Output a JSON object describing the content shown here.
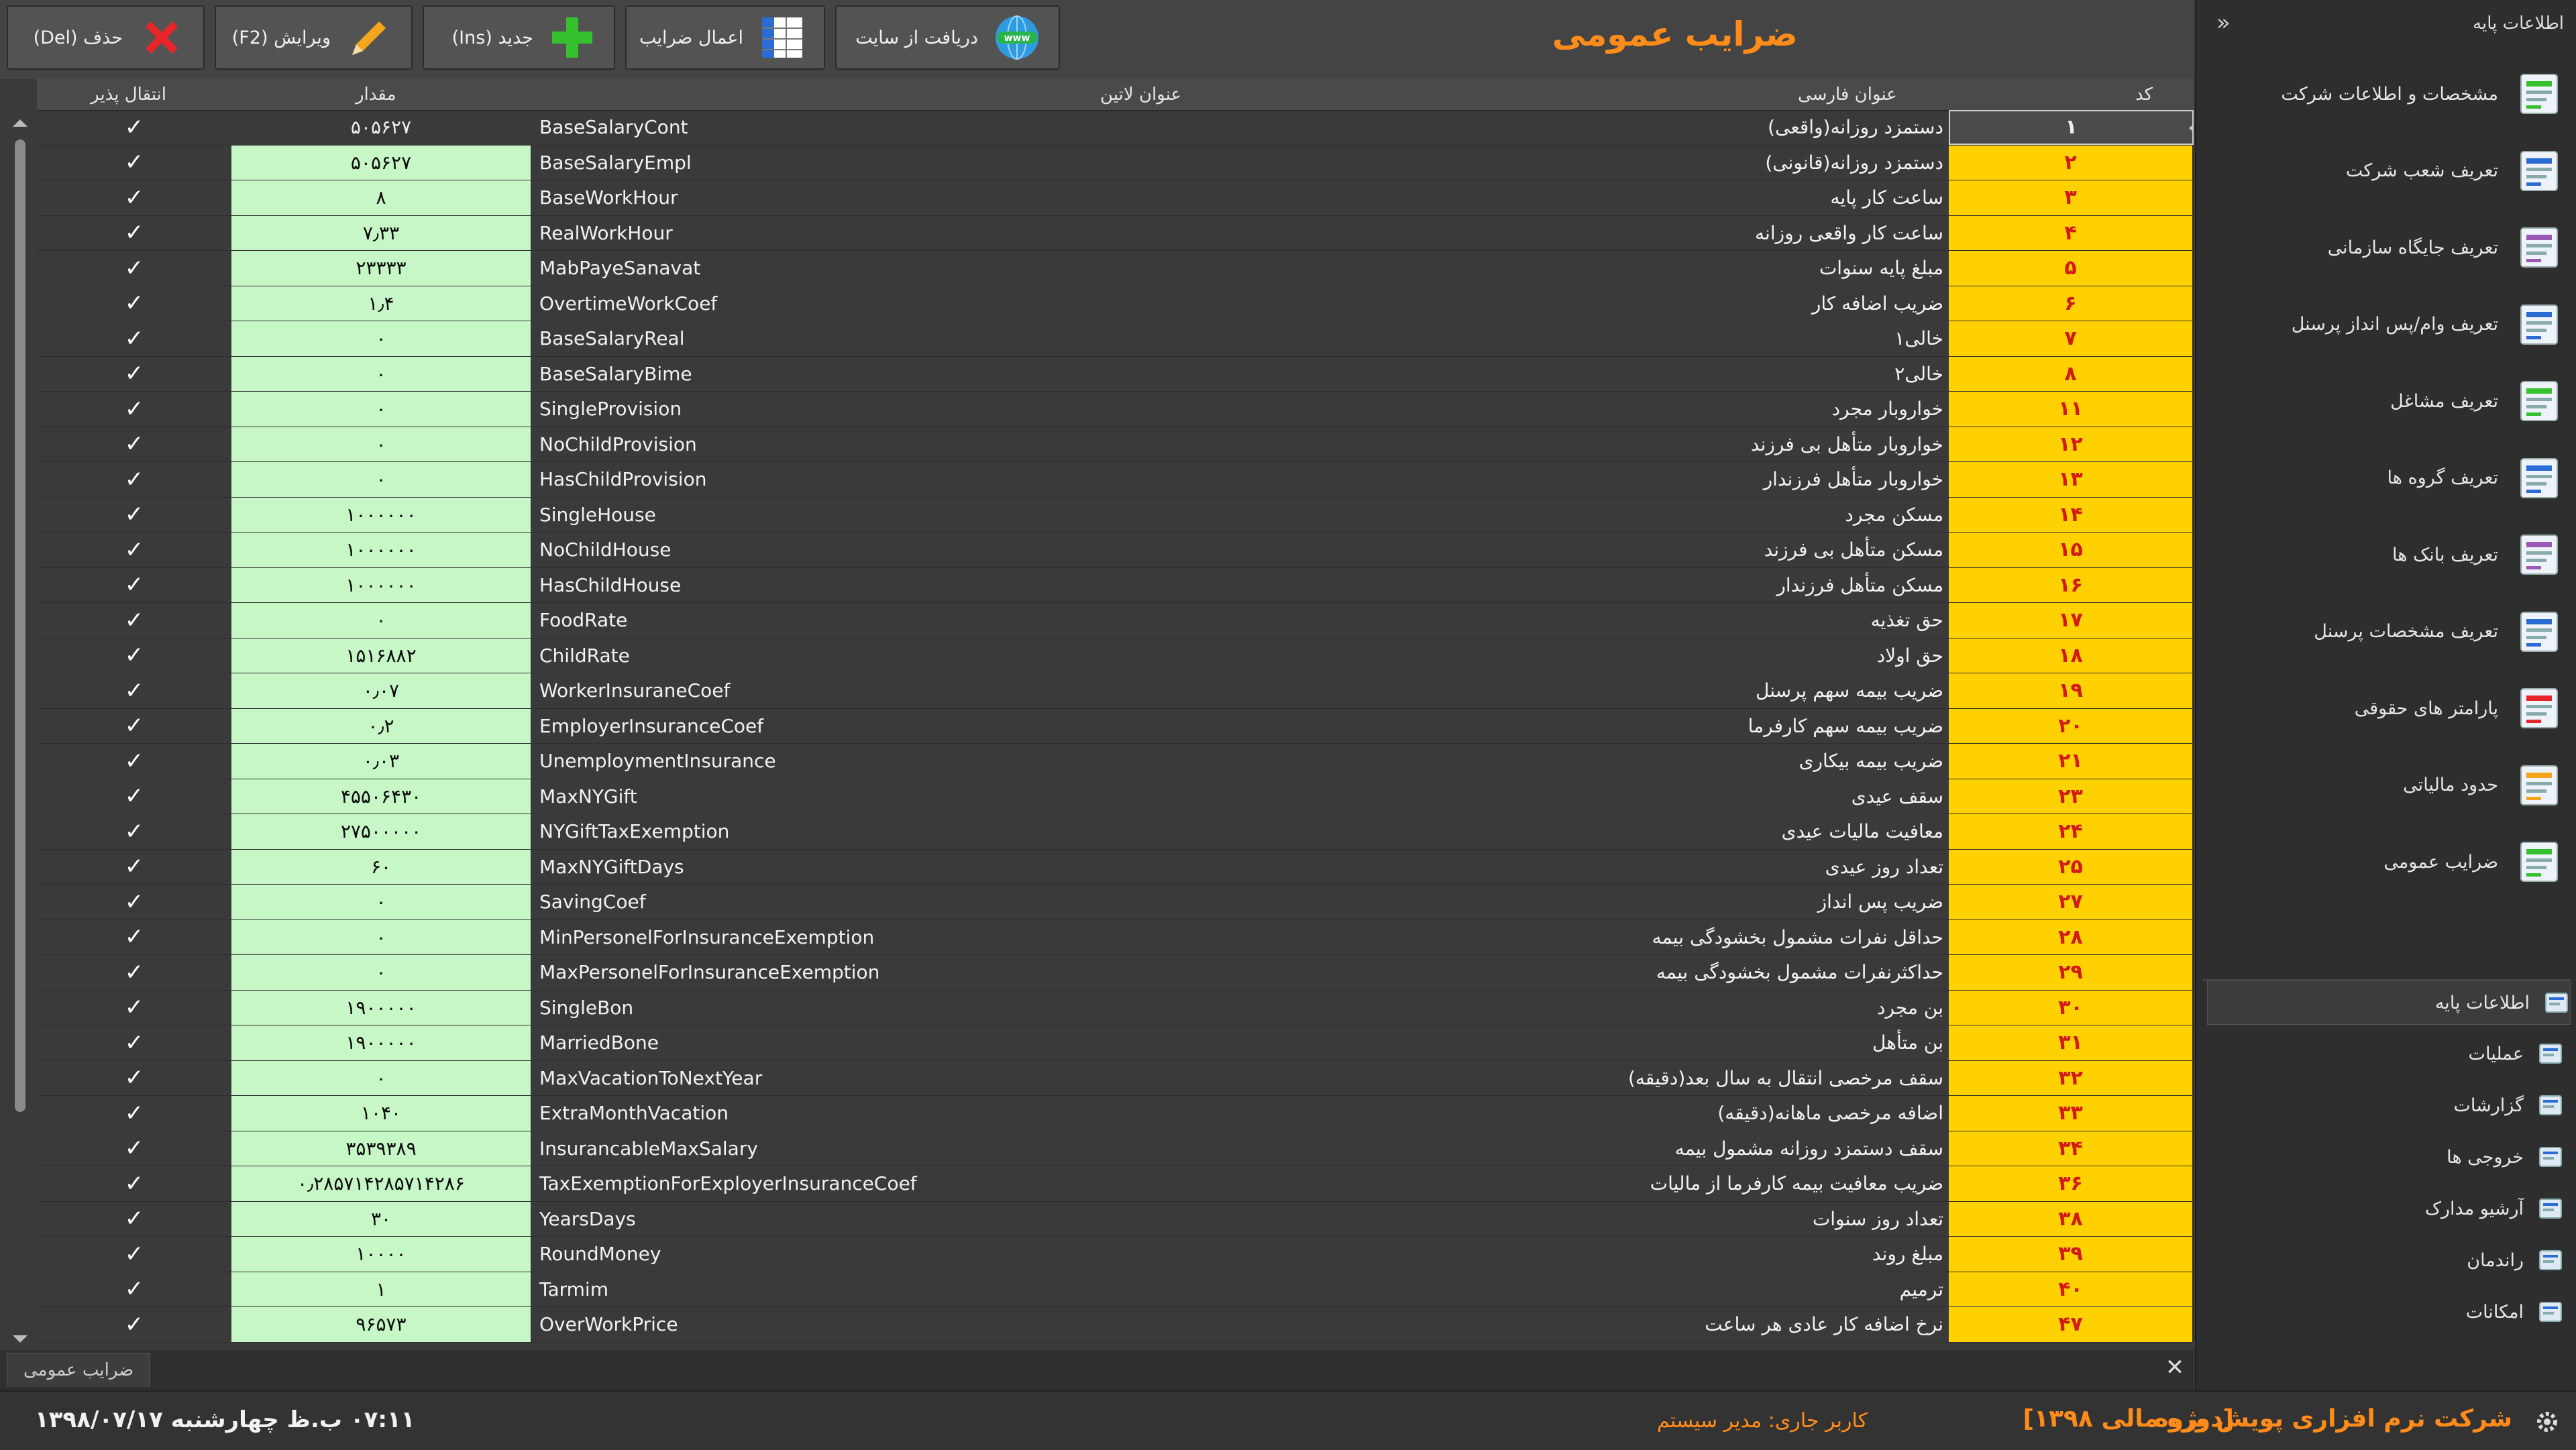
{
  "toolbar": {
    "title": "ضرایب عمومی",
    "buttons": {
      "download": "دریافت از سایت",
      "apply": "اعمال ضرایب",
      "new": "جدید (Ins)",
      "edit": "ویرایش (F2)",
      "delete": "حذف (Del)"
    }
  },
  "grid": {
    "columns": {
      "code": "کد",
      "persian_title": "عنوان فارسی",
      "latin_title": "عنوان لاتین",
      "value": "مقدار",
      "transferable": "انتقال پذیر"
    },
    "rows": [
      {
        "code": "۱",
        "fa": "دستمزد روزانه(واقعی)",
        "latin": "BaseSalaryCont",
        "value": "۵۰۵۶۲۷",
        "transferable": "✓"
      },
      {
        "code": "۲",
        "fa": "دستمزد روزانه(قانونی)",
        "latin": "BaseSalaryEmpl",
        "value": "۵۰۵۶۲۷",
        "transferable": "✓"
      },
      {
        "code": "۳",
        "fa": "ساعت کار پایه",
        "latin": "BaseWorkHour",
        "value": "۸",
        "transferable": "✓"
      },
      {
        "code": "۴",
        "fa": "ساعت کار واقعی روزانه",
        "latin": "RealWorkHour",
        "value": "۷٫۳۳",
        "transferable": "✓"
      },
      {
        "code": "۵",
        "fa": "مبلغ پایه سنوات",
        "latin": "MabPayeSanavat",
        "value": "۲۳۳۳۳",
        "transferable": "✓"
      },
      {
        "code": "۶",
        "fa": "ضریب اضافه کار",
        "latin": "OvertimeWorkCoef",
        "value": "۱٫۴",
        "transferable": "✓"
      },
      {
        "code": "۷",
        "fa": "خالی۱",
        "latin": "BaseSalaryReal",
        "value": "۰",
        "transferable": "✓"
      },
      {
        "code": "۸",
        "fa": "خالی۲",
        "latin": "BaseSalaryBime",
        "value": "۰",
        "transferable": "✓"
      },
      {
        "code": "۱۱",
        "fa": "خواروبار مجرد",
        "latin": "SingleProvision",
        "value": "۰",
        "transferable": "✓"
      },
      {
        "code": "۱۲",
        "fa": "خواروبار متأهل بی فرزند",
        "latin": "NoChildProvision",
        "value": "۰",
        "transferable": "✓"
      },
      {
        "code": "۱۳",
        "fa": "خواروبار متأهل فرزندار",
        "latin": "HasChildProvision",
        "value": "۰",
        "transferable": "✓"
      },
      {
        "code": "۱۴",
        "fa": "مسکن مجرد",
        "latin": "SingleHouse",
        "value": "۱۰۰۰۰۰۰",
        "transferable": "✓"
      },
      {
        "code": "۱۵",
        "fa": "مسکن متأهل بی فرزند",
        "latin": "NoChildHouse",
        "value": "۱۰۰۰۰۰۰",
        "transferable": "✓"
      },
      {
        "code": "۱۶",
        "fa": "مسکن متأهل فرزندار",
        "latin": "HasChildHouse",
        "value": "۱۰۰۰۰۰۰",
        "transferable": "✓"
      },
      {
        "code": "۱۷",
        "fa": "حق تغذیه",
        "latin": "FoodRate",
        "value": "۰",
        "transferable": "✓"
      },
      {
        "code": "۱۸",
        "fa": "حق اولاد",
        "latin": "ChildRate",
        "value": "۱۵۱۶۸۸۲",
        "transferable": "✓"
      },
      {
        "code": "۱۹",
        "fa": "ضریب بیمه سهم پرسنل",
        "latin": "WorkerInsuraneCoef",
        "value": "۰٫۰۷",
        "transferable": "✓"
      },
      {
        "code": "۲۰",
        "fa": "ضریب بیمه سهم کارفرما",
        "latin": "EmployerInsuranceCoef",
        "value": "۰٫۲",
        "transferable": "✓"
      },
      {
        "code": "۲۱",
        "fa": "ضریب بیمه بیکاری",
        "latin": "UnemploymentInsurance",
        "value": "۰٫۰۳",
        "transferable": "✓"
      },
      {
        "code": "۲۳",
        "fa": "سقف عیدی",
        "latin": "MaxNYGift",
        "value": "۴۵۵۰۶۴۳۰",
        "transferable": "✓"
      },
      {
        "code": "۲۴",
        "fa": "معافیت مالیات عیدی",
        "latin": "NYGiftTaxExemption",
        "value": "۲۷۵۰۰۰۰۰",
        "transferable": "✓"
      },
      {
        "code": "۲۵",
        "fa": "تعداد روز عیدی",
        "latin": "MaxNYGiftDays",
        "value": "۶۰",
        "transferable": "✓"
      },
      {
        "code": "۲۷",
        "fa": "ضریب پس انداز",
        "latin": "SavingCoef",
        "value": "۰",
        "transferable": "✓"
      },
      {
        "code": "۲۸",
        "fa": "حداقل نفرات مشمول بخشودگی بیمه",
        "latin": "MinPersonelForInsuranceExemption",
        "value": "۰",
        "transferable": "✓"
      },
      {
        "code": "۲۹",
        "fa": "حداکثرنفرات مشمول بخشودگی بیمه",
        "latin": "MaxPersonelForInsuranceExemption",
        "value": "۰",
        "transferable": "✓"
      },
      {
        "code": "۳۰",
        "fa": "بن مجرد",
        "latin": "SingleBon",
        "value": "۱۹۰۰۰۰۰",
        "transferable": "✓"
      },
      {
        "code": "۳۱",
        "fa": "بن متأهل",
        "latin": "MarriedBone",
        "value": "۱۹۰۰۰۰۰",
        "transferable": "✓"
      },
      {
        "code": "۳۲",
        "fa": "سقف مرخصی انتقال به سال بعد(دقیقه)",
        "latin": "MaxVacationToNextYear",
        "value": "۰",
        "transferable": "✓"
      },
      {
        "code": "۳۳",
        "fa": "اضافه مرخصی ماهانه(دقیقه)",
        "latin": "ExtraMonthVacation",
        "value": "۱۰۴۰",
        "transferable": "✓"
      },
      {
        "code": "۳۴",
        "fa": "سقف دستمزد روزانه مشمول بیمه",
        "latin": "InsurancableMaxSalary",
        "value": "۳۵۳۹۳۸۹",
        "transferable": "✓"
      },
      {
        "code": "۳۶",
        "fa": "ضریب معافیت بیمه کارفرما از مالیات",
        "latin": "TaxExemptionForExployerInsuranceCoef",
        "value": "۰٫۲۸۵۷۱۴۲۸۵۷۱۴۲۸۶",
        "transferable": "✓"
      },
      {
        "code": "۳۸",
        "fa": "تعداد روز سنوات",
        "latin": "YearsDays",
        "value": "۳۰",
        "transferable": "✓"
      },
      {
        "code": "۳۹",
        "fa": "مبلغ روند",
        "latin": "RoundMoney",
        "value": "۱۰۰۰۰",
        "transferable": "✓"
      },
      {
        "code": "۴۰",
        "fa": "ترمیم",
        "latin": "Tarmim",
        "value": "۱",
        "transferable": "✓"
      },
      {
        "code": "۴۷",
        "fa": "نرخ اضافه کار عادی هر ساعت",
        "latin": "OverWorkPrice",
        "value": "۹۶۵۷۳",
        "transferable": "✓"
      }
    ]
  },
  "tabbar": {
    "tab_label": "ضرایب عمومی",
    "close": "✕"
  },
  "statusbar": {
    "company": "شرکت نرم افزاری پویش پژوه",
    "fiscal": "[دوره مالی ۱۳۹۸]",
    "user": "کاربر جاری: مدیر سیستم",
    "datetime": "۰۷:۱۱ ب.ظ  چهارشنبه ۱۳۹۸/۰۷/۱۷"
  },
  "sidebar": {
    "header": "اطلاعات پایه",
    "collapse": "»",
    "items": [
      {
        "label": "مشخصات و اطلاعات شرکت",
        "icon": "company-info-icon"
      },
      {
        "label": "تعریف شعب شرکت",
        "icon": "branches-icon"
      },
      {
        "label": "تعریف جایگاه سازمانی",
        "icon": "org-position-icon"
      },
      {
        "label": "تعریف وام/پس انداز پرسنل",
        "icon": "loan-icon"
      },
      {
        "label": "تعریف مشاغل",
        "icon": "jobs-icon"
      },
      {
        "label": "تعریف گروه ها",
        "icon": "groups-icon"
      },
      {
        "label": "تعریف بانک ها",
        "icon": "bank-icon"
      },
      {
        "label": "تعریف مشخصات پرسنل",
        "icon": "personnel-icon"
      },
      {
        "label": "پارامتر های حقوقی",
        "icon": "salary-params-icon"
      },
      {
        "label": "حدود مالیاتی",
        "icon": "tax-icon"
      },
      {
        "label": "ضرایب عمومی",
        "icon": "coefficients-icon"
      }
    ],
    "nav": [
      {
        "label": "اطلاعات پایه",
        "icon": "base-info-icon"
      },
      {
        "label": "عملیات",
        "icon": "operations-icon"
      },
      {
        "label": "گزارشات",
        "icon": "reports-icon"
      },
      {
        "label": "خروجی ها",
        "icon": "exports-icon"
      },
      {
        "label": "آرشیو مدارک",
        "icon": "archive-icon"
      },
      {
        "label": "راندمان",
        "icon": "efficiency-icon"
      },
      {
        "label": "امکانات",
        "icon": "tools-icon"
      }
    ]
  },
  "colors": {
    "accent": "#ff8c1a",
    "code_bg": "#ffd100",
    "code_text": "#d21a1a",
    "value_bg": "#c7f7c7"
  }
}
